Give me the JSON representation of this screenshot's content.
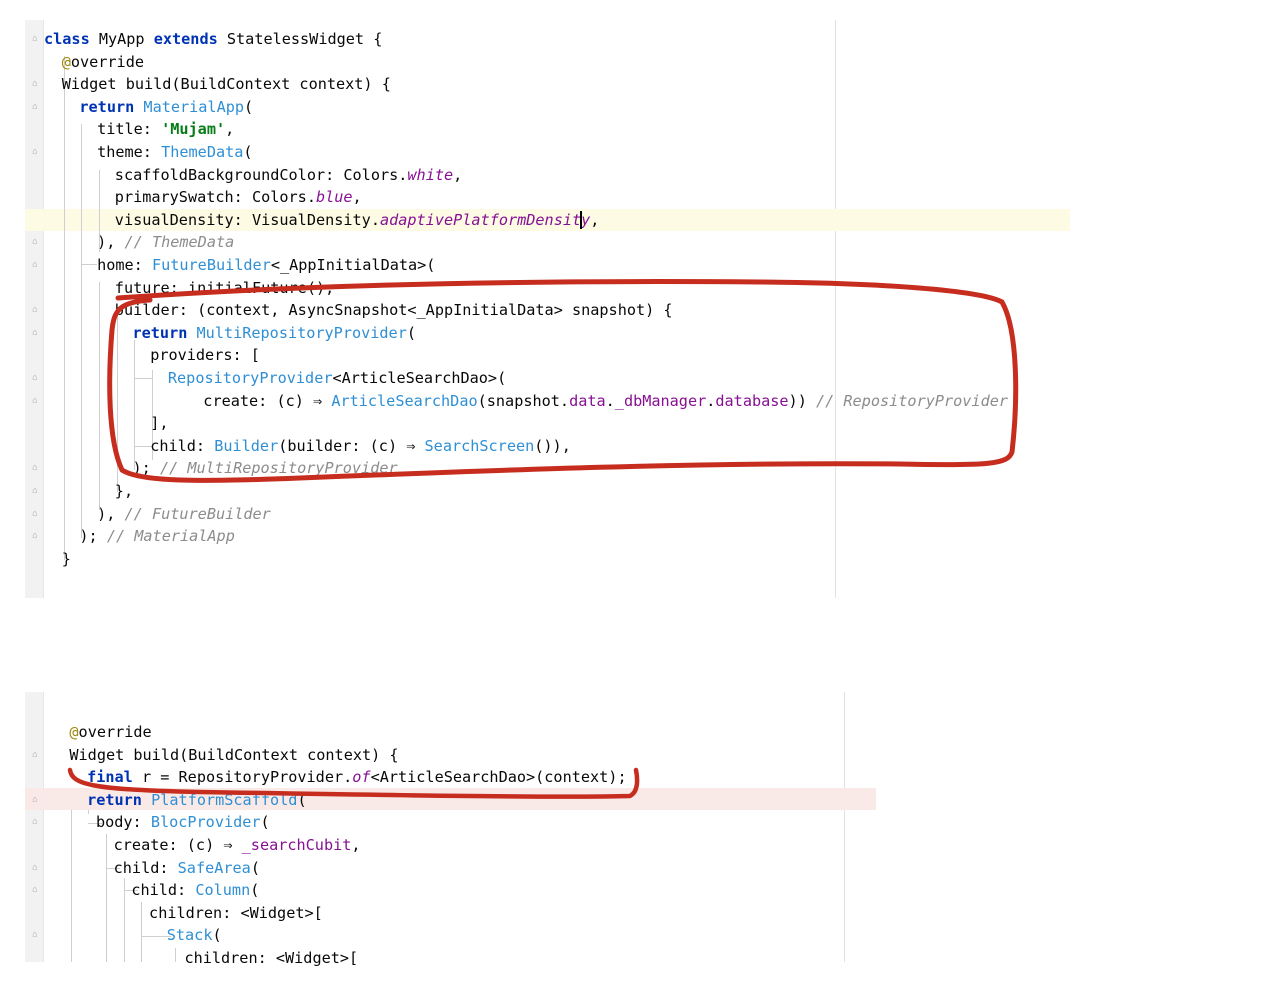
{
  "panel_top": {
    "lines": [
      [
        {
          "t": "class",
          "c": "kw"
        },
        {
          "t": " MyApp "
        },
        {
          "t": "extends",
          "c": "kw"
        },
        {
          "t": " StatelessWidget {"
        }
      ],
      [
        {
          "t": "@",
          "c": "ann"
        },
        {
          "t": "override"
        }
      ],
      [
        {
          "t": "Widget build(BuildContext context) {"
        }
      ],
      [
        {
          "t": "return",
          "c": "kw"
        },
        {
          "t": " "
        },
        {
          "t": "MaterialApp",
          "c": "cls"
        },
        {
          "t": "("
        }
      ],
      [
        {
          "t": "title: "
        },
        {
          "t": "'Mujam'",
          "c": "str"
        },
        {
          "t": ","
        }
      ],
      [
        {
          "t": "theme: "
        },
        {
          "t": "ThemeData",
          "c": "cls"
        },
        {
          "t": "("
        }
      ],
      [
        {
          "t": "scaffoldBackgroundColor: Colors."
        },
        {
          "t": "white",
          "c": "static"
        },
        {
          "t": ","
        }
      ],
      [
        {
          "t": "primarySwatch: Colors."
        },
        {
          "t": "blue",
          "c": "static"
        },
        {
          "t": ","
        }
      ],
      [
        {
          "t": "visualDensity: VisualDensity."
        },
        {
          "t": "adaptivePlatformDensity",
          "c": "static"
        },
        {
          "t": ","
        }
      ],
      [
        {
          "t": "), "
        },
        {
          "t": "// ThemeData",
          "c": "cmt"
        }
      ],
      [
        {
          "t": "home: "
        },
        {
          "t": "FutureBuilder",
          "c": "cls"
        },
        {
          "t": "<_AppInitialData>("
        }
      ],
      [
        {
          "t": "future: initialFuture(),"
        }
      ],
      [
        {
          "t": "builder: (context, AsyncSnapshot<_AppInitialData> snapshot) {"
        }
      ],
      [
        {
          "t": "return",
          "c": "kw"
        },
        {
          "t": " "
        },
        {
          "t": "MultiRepositoryProvider",
          "c": "cls"
        },
        {
          "t": "("
        }
      ],
      [
        {
          "t": "providers: ["
        }
      ],
      [
        {
          "t": "RepositoryProvider",
          "c": "cls"
        },
        {
          "t": "<ArticleSearchDao>("
        }
      ],
      [
        {
          "t": "create: (c) ⇒ "
        },
        {
          "t": "ArticleSearchDao",
          "c": "cls"
        },
        {
          "t": "(snapshot."
        },
        {
          "t": "data",
          "c": "prop"
        },
        {
          "t": "."
        },
        {
          "t": "_dbManager",
          "c": "prop"
        },
        {
          "t": "."
        },
        {
          "t": "database",
          "c": "prop"
        },
        {
          "t": ")) "
        },
        {
          "t": "// RepositoryProvider",
          "c": "cmt"
        }
      ],
      [
        {
          "t": "],"
        }
      ],
      [
        {
          "t": "child: "
        },
        {
          "t": "Builder",
          "c": "cls"
        },
        {
          "t": "(builder: (c) ⇒ "
        },
        {
          "t": "SearchScreen",
          "c": "cls"
        },
        {
          "t": "()),"
        }
      ],
      [
        {
          "t": "); "
        },
        {
          "t": "// MultiRepositoryProvider",
          "c": "cmt"
        }
      ],
      [
        {
          "t": "},"
        }
      ],
      [
        {
          "t": "), "
        },
        {
          "t": "// FutureBuilder",
          "c": "cmt"
        }
      ],
      [
        {
          "t": "); "
        },
        {
          "t": "// MaterialApp",
          "c": "cmt"
        }
      ],
      [
        {
          "t": "}"
        }
      ]
    ]
  },
  "panel_bottom": {
    "lines": [
      [
        {
          "t": "@",
          "c": "ann"
        },
        {
          "t": "override"
        }
      ],
      [
        {
          "t": "Widget build(BuildContext context) {"
        }
      ],
      [
        {
          "t": "final",
          "c": "kw"
        },
        {
          "t": " r = RepositoryProvider."
        },
        {
          "t": "of",
          "c": "static"
        },
        {
          "t": "<ArticleSearchDao>(context);"
        }
      ],
      [
        {
          "t": "return",
          "c": "kw"
        },
        {
          "t": " "
        },
        {
          "t": "PlatformScaffold",
          "c": "cls"
        },
        {
          "t": "("
        }
      ],
      [
        {
          "t": "body: "
        },
        {
          "t": "BlocProvider",
          "c": "cls"
        },
        {
          "t": "("
        }
      ],
      [
        {
          "t": "create: (c) ⇒ "
        },
        {
          "t": "_searchCubit",
          "c": "prop"
        },
        {
          "t": ","
        }
      ],
      [
        {
          "t": "child: "
        },
        {
          "t": "SafeArea",
          "c": "cls"
        },
        {
          "t": "("
        }
      ],
      [
        {
          "t": "child: "
        },
        {
          "t": "Column",
          "c": "cls"
        },
        {
          "t": "("
        }
      ],
      [
        {
          "t": "children: <Widget>["
        }
      ],
      [
        {
          "t": "Stack",
          "c": "cls"
        },
        {
          "t": "("
        }
      ],
      [
        {
          "t": "children: <Widget>["
        }
      ]
    ]
  },
  "colors": {
    "keyword": "#0033b3",
    "class": "#2f8fd4",
    "string": "#067d17",
    "property": "#871094",
    "comment": "#8c8c8c",
    "annotation_marker": "#c62d1f",
    "caret_row_highlight": "#fdfbe4",
    "breakpoint_row_highlight": "#faeae7"
  }
}
